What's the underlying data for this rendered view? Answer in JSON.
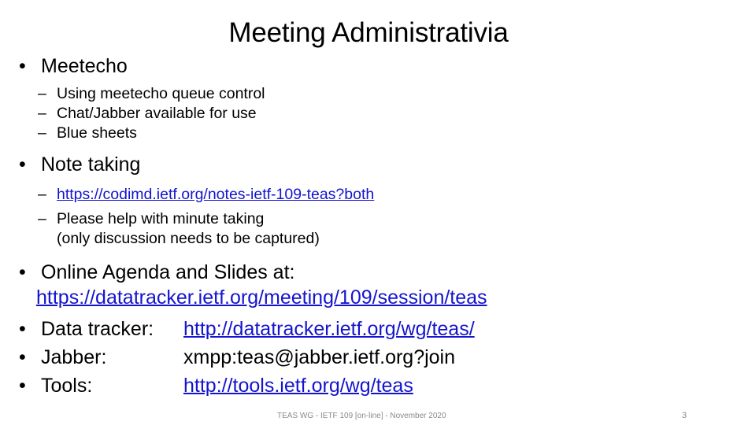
{
  "slide": {
    "title": "Meeting Administrativia",
    "page_number": "3",
    "footer": "TEAS WG - IETF 109 [on-line] - November 2020",
    "bullet_glyph": "•",
    "dash_glyph": "–",
    "link_color": "#1414CE",
    "text_color": "#000000",
    "footer_color": "#8a8a8a",
    "background_color": "#ffffff"
  },
  "content": {
    "section_meetecho": {
      "heading": "Meetecho",
      "items": [
        "Using meetecho queue control",
        "Chat/Jabber available for use",
        "Blue sheets"
      ]
    },
    "section_note_taking": {
      "heading": "Note taking",
      "link": "https://codimd.ietf.org/notes-ietf-109-teas?both",
      "item": "Please help with minute taking",
      "item_continuation": "(only discussion needs to be captured)"
    },
    "section_online_agenda": {
      "heading": "Online Agenda and Slides at:",
      "link": "https://datatracker.ietf.org/meeting/109/session/teas"
    },
    "rows": [
      {
        "label": "Data tracker:",
        "value": "http://datatracker.ietf.org/wg/teas/",
        "is_link": true
      },
      {
        "label": "Jabber:",
        "value": "xmpp:teas@jabber.ietf.org?join",
        "is_link": false
      },
      {
        "label": "Tools:",
        "value": "http://tools.ietf.org/wg/teas",
        "is_link": true
      }
    ]
  }
}
